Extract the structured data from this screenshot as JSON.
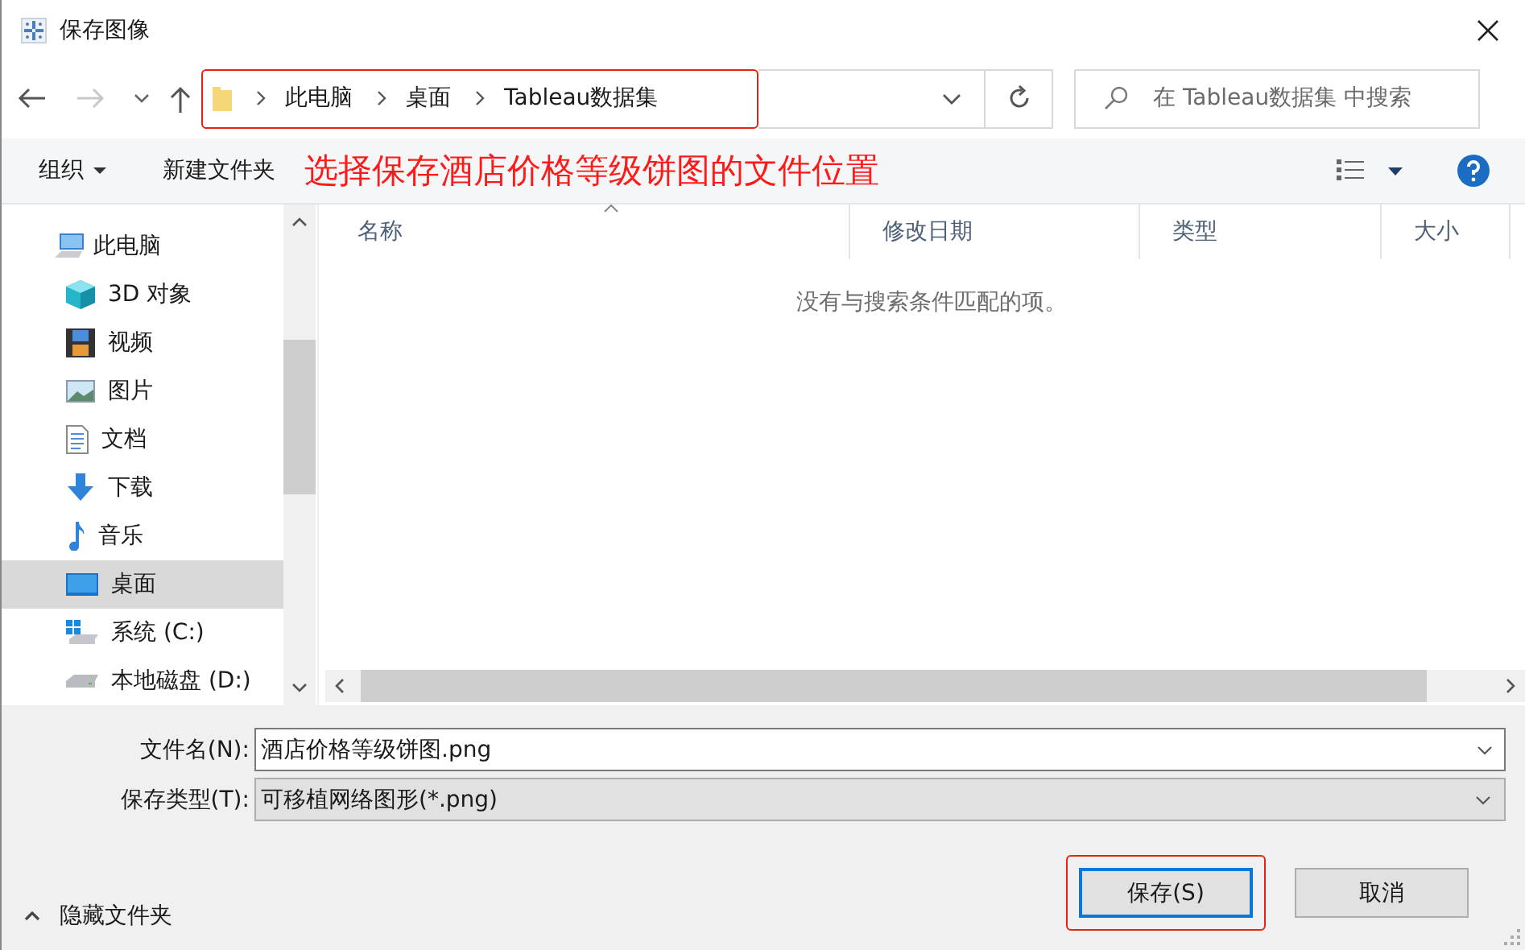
{
  "window": {
    "title": "保存图像"
  },
  "address_bar": {
    "highlighted": true,
    "crumbs": [
      "此电脑",
      "桌面",
      "Tableau数据集"
    ]
  },
  "search": {
    "placeholder": "在 Tableau数据集 中搜索"
  },
  "toolbar": {
    "organize": "组织",
    "new_folder": "新建文件夹",
    "annotation": "选择保存酒店价格等级饼图的文件位置"
  },
  "sidebar": {
    "items": [
      {
        "label": "此电脑",
        "kind": "pc",
        "selected": false,
        "children": [
          {
            "label": "3D 对象",
            "kind": "cube",
            "selected": false
          },
          {
            "label": "视频",
            "kind": "video",
            "selected": false
          },
          {
            "label": "图片",
            "kind": "picture",
            "selected": false
          },
          {
            "label": "文档",
            "kind": "document",
            "selected": false
          },
          {
            "label": "下载",
            "kind": "download",
            "selected": false
          },
          {
            "label": "音乐",
            "kind": "music",
            "selected": false
          },
          {
            "label": "桌面",
            "kind": "desktop",
            "selected": true
          },
          {
            "label": "系统 (C:)",
            "kind": "drive_c",
            "selected": false
          },
          {
            "label": "本地磁盘 (D:)",
            "kind": "drive",
            "selected": false
          }
        ]
      }
    ]
  },
  "table": {
    "columns": [
      "名称",
      "修改日期",
      "类型",
      "大小"
    ],
    "empty_message": "没有与搜索条件匹配的项。"
  },
  "form": {
    "file_name_label": "文件名(N):",
    "file_name": "酒店价格等级饼图.png",
    "type_label": "保存类型(T):",
    "type": "可移植网络图形(*.png)"
  },
  "hide_folders": "隐藏文件夹",
  "buttons": [
    {
      "label": "保存(S)",
      "kind": "primary",
      "highlighted": true
    },
    {
      "label": "取消",
      "kind": "normal",
      "highlighted": false
    }
  ]
}
